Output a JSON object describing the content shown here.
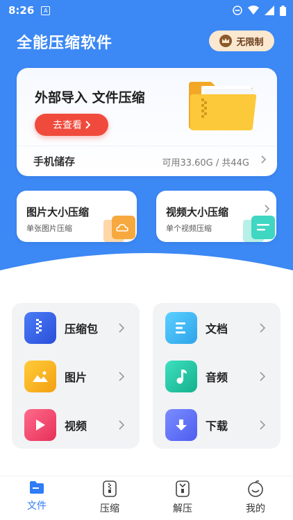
{
  "status_bar": {
    "time": "8:26",
    "notif_icon": "A"
  },
  "header": {
    "title": "全能压缩软件",
    "vip_label": "无限制"
  },
  "main_card": {
    "headline": "外部导入 文件压缩",
    "go_button": "去查看",
    "storage_label": "手机储存",
    "storage_value": "可用33.60G / 共44G"
  },
  "quick_cards": [
    {
      "title": "图片大小压缩",
      "subtitle": "单张图片压缩"
    },
    {
      "title": "视频大小压缩",
      "subtitle": "单个视频压缩"
    }
  ],
  "categories": [
    {
      "label": "压缩包",
      "icon": "zip-icon",
      "color": "#3d6df2"
    },
    {
      "label": "文档",
      "icon": "document-icon",
      "color": "#3bb6f0"
    },
    {
      "label": "图片",
      "icon": "image-icon",
      "color": "#f6b21e"
    },
    {
      "label": "音频",
      "icon": "music-icon",
      "color": "#26c8a6"
    },
    {
      "label": "视频",
      "icon": "video-icon",
      "color": "#f0476a"
    },
    {
      "label": "下载",
      "icon": "download-icon",
      "color": "#5b6ff5"
    }
  ],
  "bottom_nav": [
    {
      "label": "文件",
      "active": true
    },
    {
      "label": "压缩",
      "active": false
    },
    {
      "label": "解压",
      "active": false
    },
    {
      "label": "我的",
      "active": false
    }
  ],
  "colors": {
    "primary": "#3c88f4",
    "accent_red": "#f04a3c",
    "active_tab": "#2e7cf6"
  }
}
